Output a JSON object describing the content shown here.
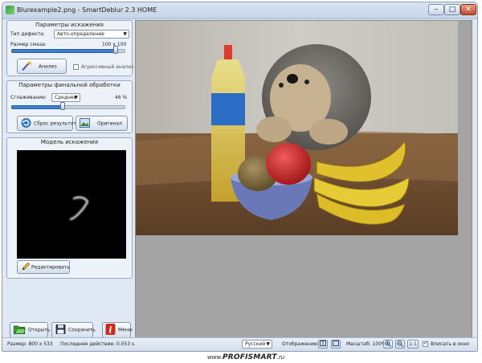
{
  "window": {
    "title": "Blurexample2.png - SmartDeblur 2.3 HOME",
    "minimize": "–",
    "maximize": "□",
    "close": "✕"
  },
  "distortion": {
    "title": "Параметры искажения",
    "defect_label": "Тип дефекта:",
    "defect_value": "Авто-определение",
    "size_label": "Размер смаза:",
    "size_value": "100 x 100",
    "size_fraction": 0.93,
    "analyze_button": "Анализ",
    "aggressive_label": "Агрессивный анализ",
    "aggressive_checked": false
  },
  "final": {
    "title": "Параметры финальной обработки",
    "smoothing_label": "Сглаживание:",
    "smoothing_value": "Среднее",
    "smoothing_percent": "46 %",
    "smoothing_fraction": 0.46,
    "reset_button": "Сброс результата",
    "original_button": "Оригинал"
  },
  "model": {
    "title": "Модель искажения",
    "edit_button": "Редактировать"
  },
  "bottom_buttons": {
    "open": "Открыть",
    "save": "Сохранить",
    "menu": "Меню"
  },
  "status": {
    "size": "Размер: 800 x 533",
    "last_action": "Последнее действие: 0.053 s",
    "language": "Русский",
    "display_label": "Отображение:",
    "zoom": "Масштаб: 100%",
    "one_to_one": "1:1",
    "fit_label": "Вписать в окно",
    "fit_checked": true
  },
  "footer": {
    "prefix": "www.",
    "brand": "PROFISMART",
    "suffix": ".ru"
  },
  "colors": {
    "accent": "#3f7fd3",
    "window_bg": "#dfe8f3",
    "viewer_bg": "#a4a4a4"
  },
  "icons": {
    "analyze": "magic-wand-icon",
    "reset": "undo-icon",
    "original": "image-icon",
    "edit": "pencil-icon",
    "open": "folder-icon",
    "save": "floppy-icon",
    "menu": "info-icon",
    "zoom_in": "zoom-in-icon",
    "zoom_out": "zoom-out-icon"
  }
}
